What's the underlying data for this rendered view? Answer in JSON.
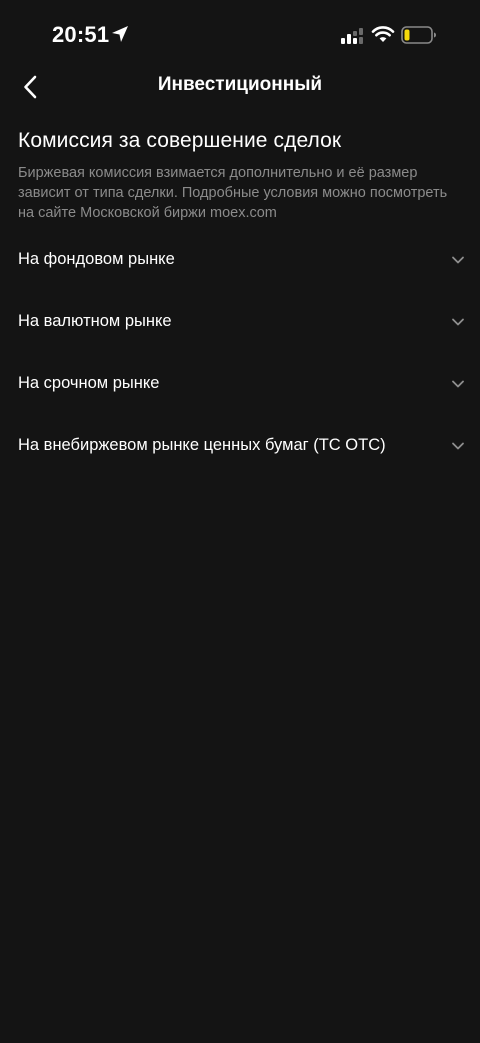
{
  "status_bar": {
    "time": "20:51"
  },
  "nav": {
    "title": "Инвестиционный"
  },
  "section": {
    "title": "Комиссия за совершение сделок",
    "description": "Биржевая комиссия взимается дополнительно и её размер зависит от типа сделки. Подробные условия можно посмотреть на сайте Московской биржи moex.com"
  },
  "accordion": {
    "items": [
      {
        "label": "На фондовом рынке"
      },
      {
        "label": "На валютном рынке"
      },
      {
        "label": "На срочном рынке"
      },
      {
        "label": "На внебиржевом рынке ценных бумаг (ТС ОТС)"
      }
    ]
  },
  "colors": {
    "background": "#141414",
    "text_primary": "#ffffff",
    "text_secondary": "#8b8b8b",
    "chevron": "#8e8e8e",
    "battery_fill": "#f5d90a"
  },
  "icons": {
    "location": "location-arrow-icon",
    "signal": "cellular-signal-icon",
    "wifi": "wifi-icon",
    "battery": "battery-icon",
    "back": "chevron-left-icon",
    "expand": "chevron-down-icon"
  },
  "battery_level": 0.2
}
